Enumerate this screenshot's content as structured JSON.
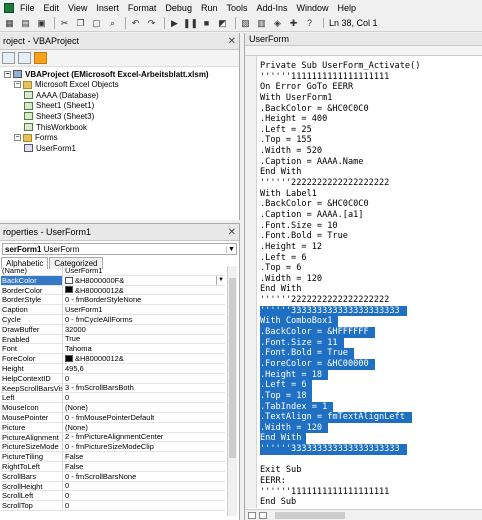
{
  "menubar": {
    "items": [
      "File",
      "Edit",
      "View",
      "Insert",
      "Format",
      "Debug",
      "Run",
      "Tools",
      "Add-Ins",
      "Window",
      "Help"
    ]
  },
  "toolbar": {
    "cursor_position": "Ln 38, Col 1"
  },
  "project": {
    "title": "roject - VBAProject",
    "tree": [
      {
        "label": "VBAProject (EMicrosoft Excel-Arbeitsblatt.xlsm)",
        "level": 0,
        "icon": "project-icon",
        "expanded": true
      },
      {
        "label": "Microsoft Excel Objects",
        "level": 1,
        "icon": "folder-icon",
        "expanded": true
      },
      {
        "label": "AAAA (Database)",
        "level": 2,
        "icon": "sheet-icon"
      },
      {
        "label": "Sheet1 (Sheet1)",
        "level": 2,
        "icon": "sheet-icon"
      },
      {
        "label": "Sheet3 (Sheet3)",
        "level": 2,
        "icon": "sheet-icon"
      },
      {
        "label": "ThisWorkbook",
        "level": 2,
        "icon": "workbook-icon"
      },
      {
        "label": "Forms",
        "level": 1,
        "icon": "folder-icon",
        "expanded": true
      },
      {
        "label": "UserForm1",
        "level": 2,
        "icon": "form-icon"
      }
    ]
  },
  "properties": {
    "title": "roperties - UserForm1",
    "object_name": "serForm1",
    "object_type": "UserForm",
    "tabs": [
      "Alphabetic",
      "Categorized"
    ],
    "rows": [
      {
        "name": "(Name)",
        "value": "UserForm1"
      },
      {
        "name": "BackColor",
        "value": "&H8000000F&",
        "swatch": "#ffffff",
        "selected": true
      },
      {
        "name": "BorderColor",
        "value": "&H80000012&",
        "swatch": "#000000"
      },
      {
        "name": "BorderStyle",
        "value": "0 - fmBorderStyleNone"
      },
      {
        "name": "Caption",
        "value": "UserForm1"
      },
      {
        "name": "Cycle",
        "value": "0 - fmCycleAllForms"
      },
      {
        "name": "DrawBuffer",
        "value": "32000"
      },
      {
        "name": "Enabled",
        "value": "True"
      },
      {
        "name": "Font",
        "value": "Tahoma"
      },
      {
        "name": "ForeColor",
        "value": "&H80000012&",
        "swatch": "#000000"
      },
      {
        "name": "Height",
        "value": "495,6"
      },
      {
        "name": "HelpContextID",
        "value": "0"
      },
      {
        "name": "KeepScrollBarsVisible",
        "value": "3 - fmScrollBarsBoth"
      },
      {
        "name": "Left",
        "value": "0"
      },
      {
        "name": "MouseIcon",
        "value": "(None)"
      },
      {
        "name": "MousePointer",
        "value": "0 - fmMousePointerDefault"
      },
      {
        "name": "Picture",
        "value": "(None)"
      },
      {
        "name": "PictureAlignment",
        "value": "2 - fmPictureAlignmentCenter"
      },
      {
        "name": "PictureSizeMode",
        "value": "0 - fmPictureSizeModeClip"
      },
      {
        "name": "PictureTiling",
        "value": "False"
      },
      {
        "name": "RightToLeft",
        "value": "False"
      },
      {
        "name": "ScrollBars",
        "value": "0 - fmScrollBarsNone"
      },
      {
        "name": "ScrollHeight",
        "value": "0"
      },
      {
        "name": "ScrollLeft",
        "value": "0"
      },
      {
        "name": "ScrollTop",
        "value": "0"
      }
    ]
  },
  "code": {
    "title": "UserForm",
    "lines": [
      {
        "text": "Private Sub UserForm_Activate()"
      },
      {
        "text": "''''''1111111111111111111"
      },
      {
        "text": "On Error GoTo EERR"
      },
      {
        "text": "With UserForm1"
      },
      {
        "text": ".BackColor = &HC0C0C0"
      },
      {
        "text": ".Height = 400"
      },
      {
        "text": ".Left = 25"
      },
      {
        "text": ".Top = 155"
      },
      {
        "text": ".Width = 520"
      },
      {
        "text": ".Caption = AAAA.Name"
      },
      {
        "text": "End With"
      },
      {
        "text": "''''''2222222222222222222"
      },
      {
        "text": "With Label1"
      },
      {
        "text": ".BackColor = &HC0C0C0"
      },
      {
        "text": ".Caption = AAAA.[a1]"
      },
      {
        "text": ".Font.Size = 10"
      },
      {
        "text": ".Font.Bold = True"
      },
      {
        "text": ".Height = 12"
      },
      {
        "text": ".Left = 6"
      },
      {
        "text": ".Top = 6"
      },
      {
        "text": ".Width = 120"
      },
      {
        "text": "End With"
      },
      {
        "text": "''''''2222222222222222222"
      },
      {
        "text": "''''''333333333333333333333",
        "selected": true
      },
      {
        "text": "With ComboBox1",
        "selected": true
      },
      {
        "text": ".BackColor = &HFFFFFF",
        "selected": true
      },
      {
        "text": ".Font.Size = 11",
        "selected": true
      },
      {
        "text": ".Font.Bold = True",
        "selected": true
      },
      {
        "text": ".ForeColor = &HC00000",
        "selected": true
      },
      {
        "text": ".Height = 18",
        "selected": true
      },
      {
        "text": ".Left = 6",
        "selected": true
      },
      {
        "text": ".Top = 18",
        "selected": true
      },
      {
        "text": ".TabIndex = 1",
        "selected": true
      },
      {
        "text": ".TextAlign = fmTextAlignLeft",
        "selected": true
      },
      {
        "text": ".Width = 120",
        "selected": true
      },
      {
        "text": "End With",
        "selected": true
      },
      {
        "text": "''''''333333333333333333333",
        "selected": true
      },
      {
        "text": ""
      },
      {
        "text": "Exit Sub"
      },
      {
        "text": "EERR:"
      },
      {
        "text": "''''''1111111111111111111"
      },
      {
        "text": "End Sub"
      }
    ]
  },
  "colors": {
    "selection": "#1f6fc2",
    "property_selection": "#3478c6"
  }
}
